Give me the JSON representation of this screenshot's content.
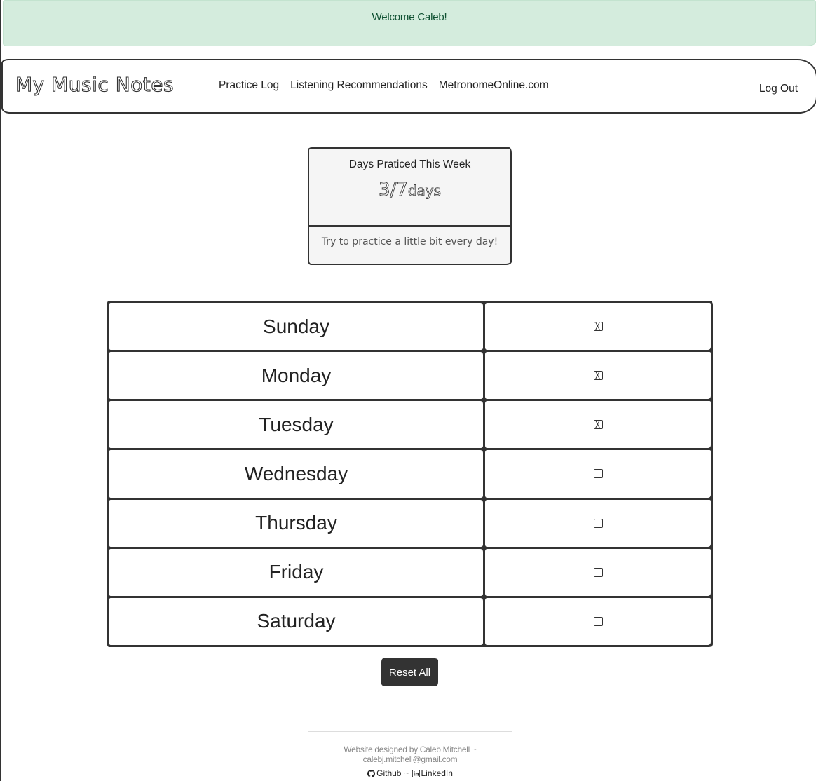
{
  "alert": {
    "welcome_text": "Welcome Caleb!"
  },
  "navbar": {
    "brand": "My Music Notes",
    "links": [
      {
        "label": "Practice Log"
      },
      {
        "label": "Listening Recommendations"
      },
      {
        "label": "MetronomeOnline.com"
      }
    ],
    "logout_label": "Log Out"
  },
  "practice_card": {
    "title": "Days Praticed This Week",
    "days_count": "3/7",
    "unit": "days",
    "message": "Try to practice a little bit every day!"
  },
  "days": [
    {
      "label": "Sunday",
      "checked": true
    },
    {
      "label": "Monday",
      "checked": true
    },
    {
      "label": "Tuesday",
      "checked": true
    },
    {
      "label": "Wednesday",
      "checked": false
    },
    {
      "label": "Thursday",
      "checked": false
    },
    {
      "label": "Friday",
      "checked": false
    },
    {
      "label": "Saturday",
      "checked": false
    }
  ],
  "reset_label": "Reset All",
  "footer": {
    "credit": "Website designed by Caleb Mitchell ~ calebj.mitchell@gmail.com",
    "separator": "~",
    "github_label": "Github",
    "linkedin_label": "LinkedIn",
    "github_icon": "github-icon",
    "linkedin_icon": "linkedin-icon"
  }
}
